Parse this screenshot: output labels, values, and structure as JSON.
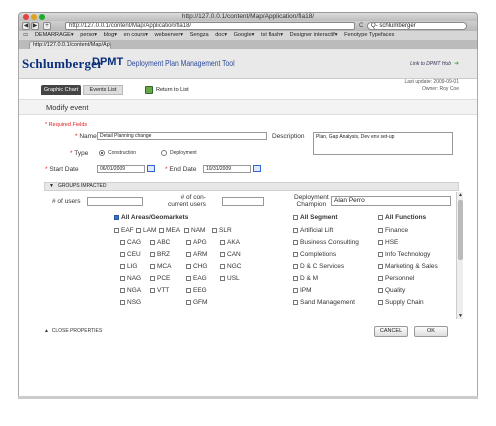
{
  "browser": {
    "window_title": "http://127.0.0.1/content/Map/Application/fla18/",
    "url": "http://127.0.0.1/content/Map/Application/fla18/",
    "reload": "C",
    "search_value": "Q- schlumberger",
    "bookmarks": [
      "DEMARRAGE▾",
      "perso▾",
      "blog▾",
      "en cours▾",
      "webserver▾",
      "Sengza",
      "doc▾",
      "Google▾",
      "tst flash▾",
      "Designer interactif▾",
      "Fenotype Typefaces"
    ],
    "tab_label": "http://127.0.0.1/content/Map/Ap..."
  },
  "header": {
    "logo": "Schlumberger",
    "app_short": "DPMT",
    "app_long": "Deployment Plan Management Tool",
    "hub_link": "Link to DPMT Hub",
    "hub_arrow": "➜"
  },
  "subnav": {
    "tab_active": "Graphic Chart",
    "tab_events": "Events List",
    "return_label": "Return to List",
    "last_update": "Last update: 2009-09-01",
    "owner": "Owner: Roy Coe"
  },
  "form": {
    "section_title": "Modify event",
    "required_note": "* Required Fields",
    "name_label": "Name",
    "name_value": "Detail Planning change",
    "description_label": "Description",
    "description_value": "Plan, Gap Analysis, Dev env set-up",
    "type_label": "Type",
    "type_options": [
      "Construction",
      "Deployment"
    ],
    "start_label": "Start Date",
    "start_value": "06/01/2009",
    "end_label": "End Date",
    "end_value": "10/31/2009"
  },
  "groups": {
    "bar_label": "GROUPS IMPACTED",
    "users_label": "# of users",
    "concurrent_label_1": "# of con-",
    "concurrent_label_2": "current users",
    "champion_label_1": "Deployment",
    "champion_label_2": "Champion",
    "champion_value": "Alan Perro",
    "all_areas": "All Areas/Geomarkets",
    "all_segment": "All Segment",
    "all_functions": "All Functions",
    "areas_row1": [
      "EAF",
      "LAM",
      "MEA",
      "NAM",
      "SLR"
    ],
    "areas_col1": [
      "CAG",
      "CEU",
      "LIG",
      "NAG",
      "NGA",
      "NSG"
    ],
    "areas_col2": [
      "ABC",
      "BRZ",
      "MCA",
      "PCE",
      "VTT"
    ],
    "areas_col3": [
      "APG",
      "ARM",
      "CHG",
      "EAG",
      "EEG",
      "GFM"
    ],
    "areas_col4": [
      "AKA",
      "CAN",
      "NGC",
      "USL"
    ],
    "segments": [
      "Artificial Lift",
      "Business Consulting",
      "Completions",
      "D & C Services",
      "D & M",
      "IPM",
      "Sand Management"
    ],
    "functions": [
      "Finance",
      "HSE",
      "Info Technology",
      "Marketing & Sales",
      "Personnel",
      "Quality",
      "Supply Chain"
    ]
  },
  "footer": {
    "close_label": "CLOSE PROPERTIES",
    "cancel": "CANCEL",
    "ok": "OK"
  }
}
